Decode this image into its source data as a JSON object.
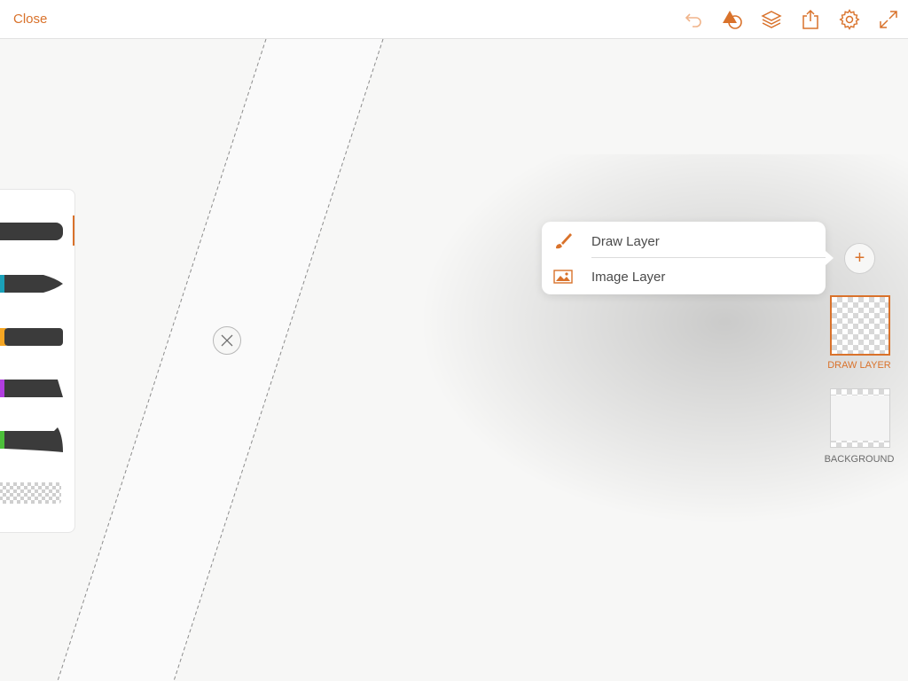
{
  "topbar": {
    "close_label": "Close",
    "icons": [
      "undo-icon",
      "shapes-icon",
      "layers-icon",
      "share-icon",
      "settings-icon",
      "fullscreen-icon"
    ]
  },
  "layer_menu": {
    "items": [
      {
        "label": "Draw Layer",
        "icon": "paintbrush-icon"
      },
      {
        "label": "Image Layer",
        "icon": "image-icon"
      }
    ]
  },
  "layers": {
    "add_label": "+",
    "items": [
      {
        "label": "DRAW LAYER",
        "selected": true
      },
      {
        "label": "BACKGROUND",
        "selected": false
      }
    ]
  },
  "brushes": {
    "items": [
      {
        "name": "brush-1",
        "color": "#444444",
        "selected": true
      },
      {
        "name": "brush-2",
        "color": "#1aa0b8"
      },
      {
        "name": "brush-3",
        "color": "#f5a623"
      },
      {
        "name": "brush-4",
        "color": "#b13ee0"
      },
      {
        "name": "brush-5",
        "color": "#4cbf3a"
      },
      {
        "name": "eraser",
        "color": "#cccccc"
      }
    ]
  },
  "colors": {
    "accent": "#d9722b"
  }
}
